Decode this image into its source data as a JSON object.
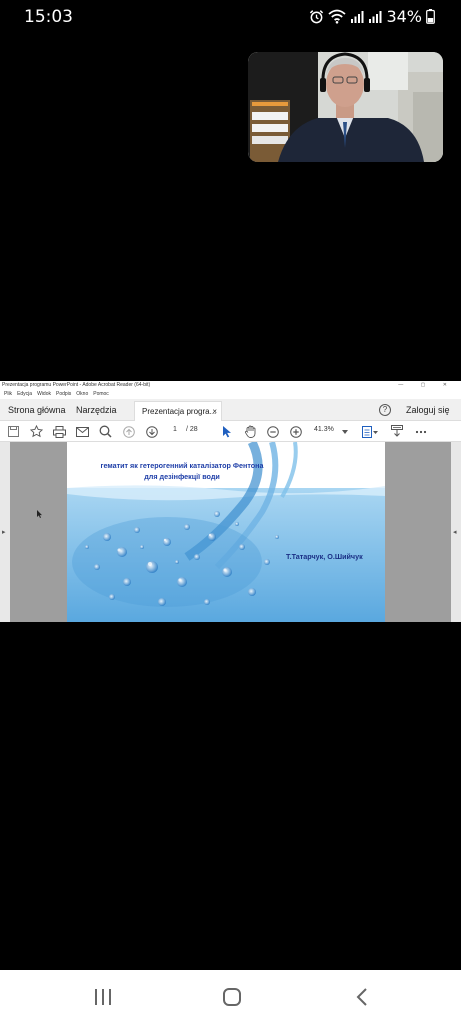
{
  "status_bar": {
    "time": "15:03",
    "battery": "34%",
    "icons": [
      "alarm-icon",
      "wifi-icon",
      "signal-icon",
      "signal-icon",
      "battery-icon"
    ]
  },
  "video_tile": {
    "participant_icon": "video-feed"
  },
  "shared_screen": {
    "window_title": "Prezentacja programu PowerPoint - Adobe Acrobat Reader (64-bit)",
    "menu": [
      "Plik",
      "Edycja",
      "Widok",
      "Podpis",
      "Okno",
      "Pomoc"
    ],
    "tabs": {
      "home": "Strona główna",
      "tools": "Narzędzia",
      "document": "Prezentacja progra...",
      "close": "×"
    },
    "help": "?",
    "login": "Zaloguj się",
    "toolbar": {
      "page_current": "1",
      "page_total": "/  28",
      "zoom": "41.3%"
    },
    "slide": {
      "title_line1": "гематит як гетерогенний каталізатор Фентона",
      "title_line2": "для дезінфекції води",
      "authors": "Т.Татарчук, О.Шийчук"
    }
  },
  "nav_bar": {
    "buttons": [
      "recent-apps-icon",
      "home-icon",
      "back-icon"
    ]
  },
  "colors": {
    "background": "#000000",
    "slide_title": "#1f3fa8",
    "water_blue": "#4a9ed6"
  }
}
